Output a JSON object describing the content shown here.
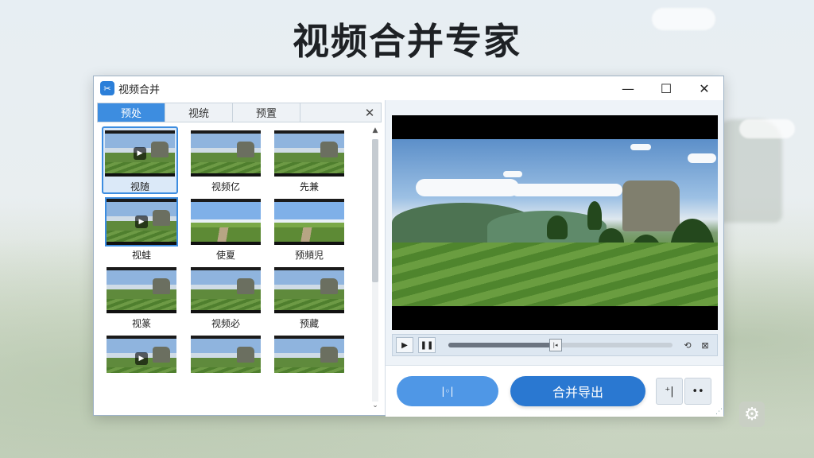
{
  "page": {
    "title": "视频合并专家"
  },
  "window": {
    "title": "视频合并",
    "app_icon": "video-merge-app-icon",
    "controls": {
      "minimize": "—",
      "maximize": "☐",
      "close": "✕"
    }
  },
  "tabs": [
    {
      "label": "预处",
      "active": true
    },
    {
      "label": "视统",
      "active": false
    },
    {
      "label": "预置",
      "active": false
    }
  ],
  "tab_close": "✕",
  "thumbnails": [
    {
      "label": "视随",
      "play": true,
      "selected": true
    },
    {
      "label": "视频亿",
      "play": false
    },
    {
      "label": "先兼",
      "play": false
    },
    {
      "label": "视蛙",
      "play": true,
      "outlined": true
    },
    {
      "label": "使夏",
      "play": false
    },
    {
      "label": "预頻児",
      "play": false
    },
    {
      "label": "视篆",
      "play": false
    },
    {
      "label": "视频必",
      "play": false
    },
    {
      "label": "预藏",
      "play": false
    },
    {
      "label": "",
      "play": true
    },
    {
      "label": "",
      "play": false
    },
    {
      "label": "",
      "play": false
    }
  ],
  "scrollbar": {
    "up": "▲",
    "down": "⌄"
  },
  "player": {
    "play_icon": "▶",
    "pause_icon": "❚❚",
    "handle_glyph": "|◂",
    "progress": 0.47,
    "volume_icon": "⟲",
    "snapshot_icon": "⊠"
  },
  "actions": {
    "left_button_label": "|◦|",
    "merge_export_label": "合并导出",
    "tool_button_1": "⁺|",
    "tool_button_2": "••"
  },
  "colors": {
    "accent": "#3d8de0",
    "merge_button": "#2a78d1",
    "left_button": "#4f97e6"
  },
  "corner_icon": "⚙"
}
